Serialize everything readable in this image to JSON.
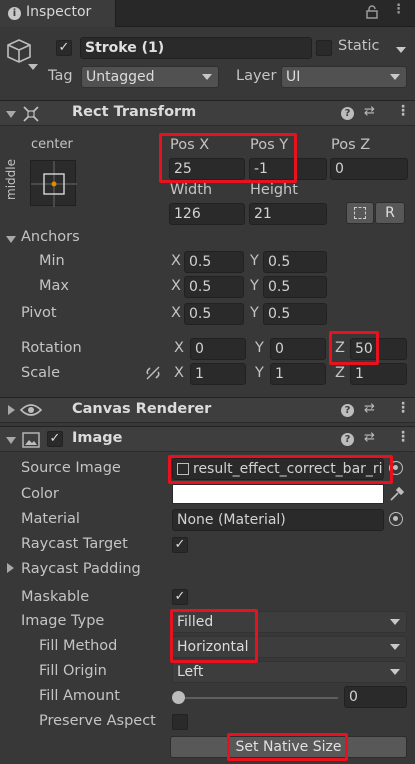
{
  "tab": {
    "title": "Inspector",
    "lock_icon": "lock-icon",
    "menu_icon": "kebab-icon"
  },
  "gameobject": {
    "name": "Stroke (1)",
    "static_label": "Static",
    "tag_label": "Tag",
    "tag_value": "Untagged",
    "layer_label": "Layer",
    "layer_value": "UI"
  },
  "rect_transform": {
    "title": "Rect Transform",
    "anchor_preset_top": "center",
    "anchor_preset_side": "middle",
    "pos_x_label": "Pos X",
    "pos_y_label": "Pos Y",
    "pos_z_label": "Pos Z",
    "pos_x": "25",
    "pos_y": "-1",
    "pos_z": "0",
    "width_label": "Width",
    "height_label": "Height",
    "width": "126",
    "height": "21",
    "raw_button": "R",
    "anchors_label": "Anchors",
    "min_label": "Min",
    "max_label": "Max",
    "min_x": "0.5",
    "min_y": "0.5",
    "max_x": "0.5",
    "max_y": "0.5",
    "pivot_label": "Pivot",
    "pivot_x": "0.5",
    "pivot_y": "0.5",
    "rotation_label": "Rotation",
    "rot_x": "0",
    "rot_y": "0",
    "rot_z": "50",
    "scale_label": "Scale",
    "scale_x": "1",
    "scale_y": "1",
    "scale_z": "1",
    "x": "X",
    "y": "Y",
    "z": "Z"
  },
  "canvas_renderer": {
    "title": "Canvas Renderer"
  },
  "image": {
    "title": "Image",
    "source_image_label": "Source Image",
    "source_image": "result_effect_correct_bar_rig",
    "color_label": "Color",
    "color_value": "#ffffff",
    "material_label": "Material",
    "material": "None (Material)",
    "raycast_target_label": "Raycast Target",
    "raycast_padding_label": "Raycast Padding",
    "maskable_label": "Maskable",
    "image_type_label": "Image Type",
    "image_type": "Filled",
    "fill_method_label": "Fill Method",
    "fill_method": "Horizontal",
    "fill_origin_label": "Fill Origin",
    "fill_origin": "Left",
    "fill_amount_label": "Fill Amount",
    "fill_amount": "0",
    "preserve_aspect_label": "Preserve Aspect",
    "set_native_size": "Set Native Size"
  },
  "check": "✓",
  "highlight_color": "#e8121e"
}
